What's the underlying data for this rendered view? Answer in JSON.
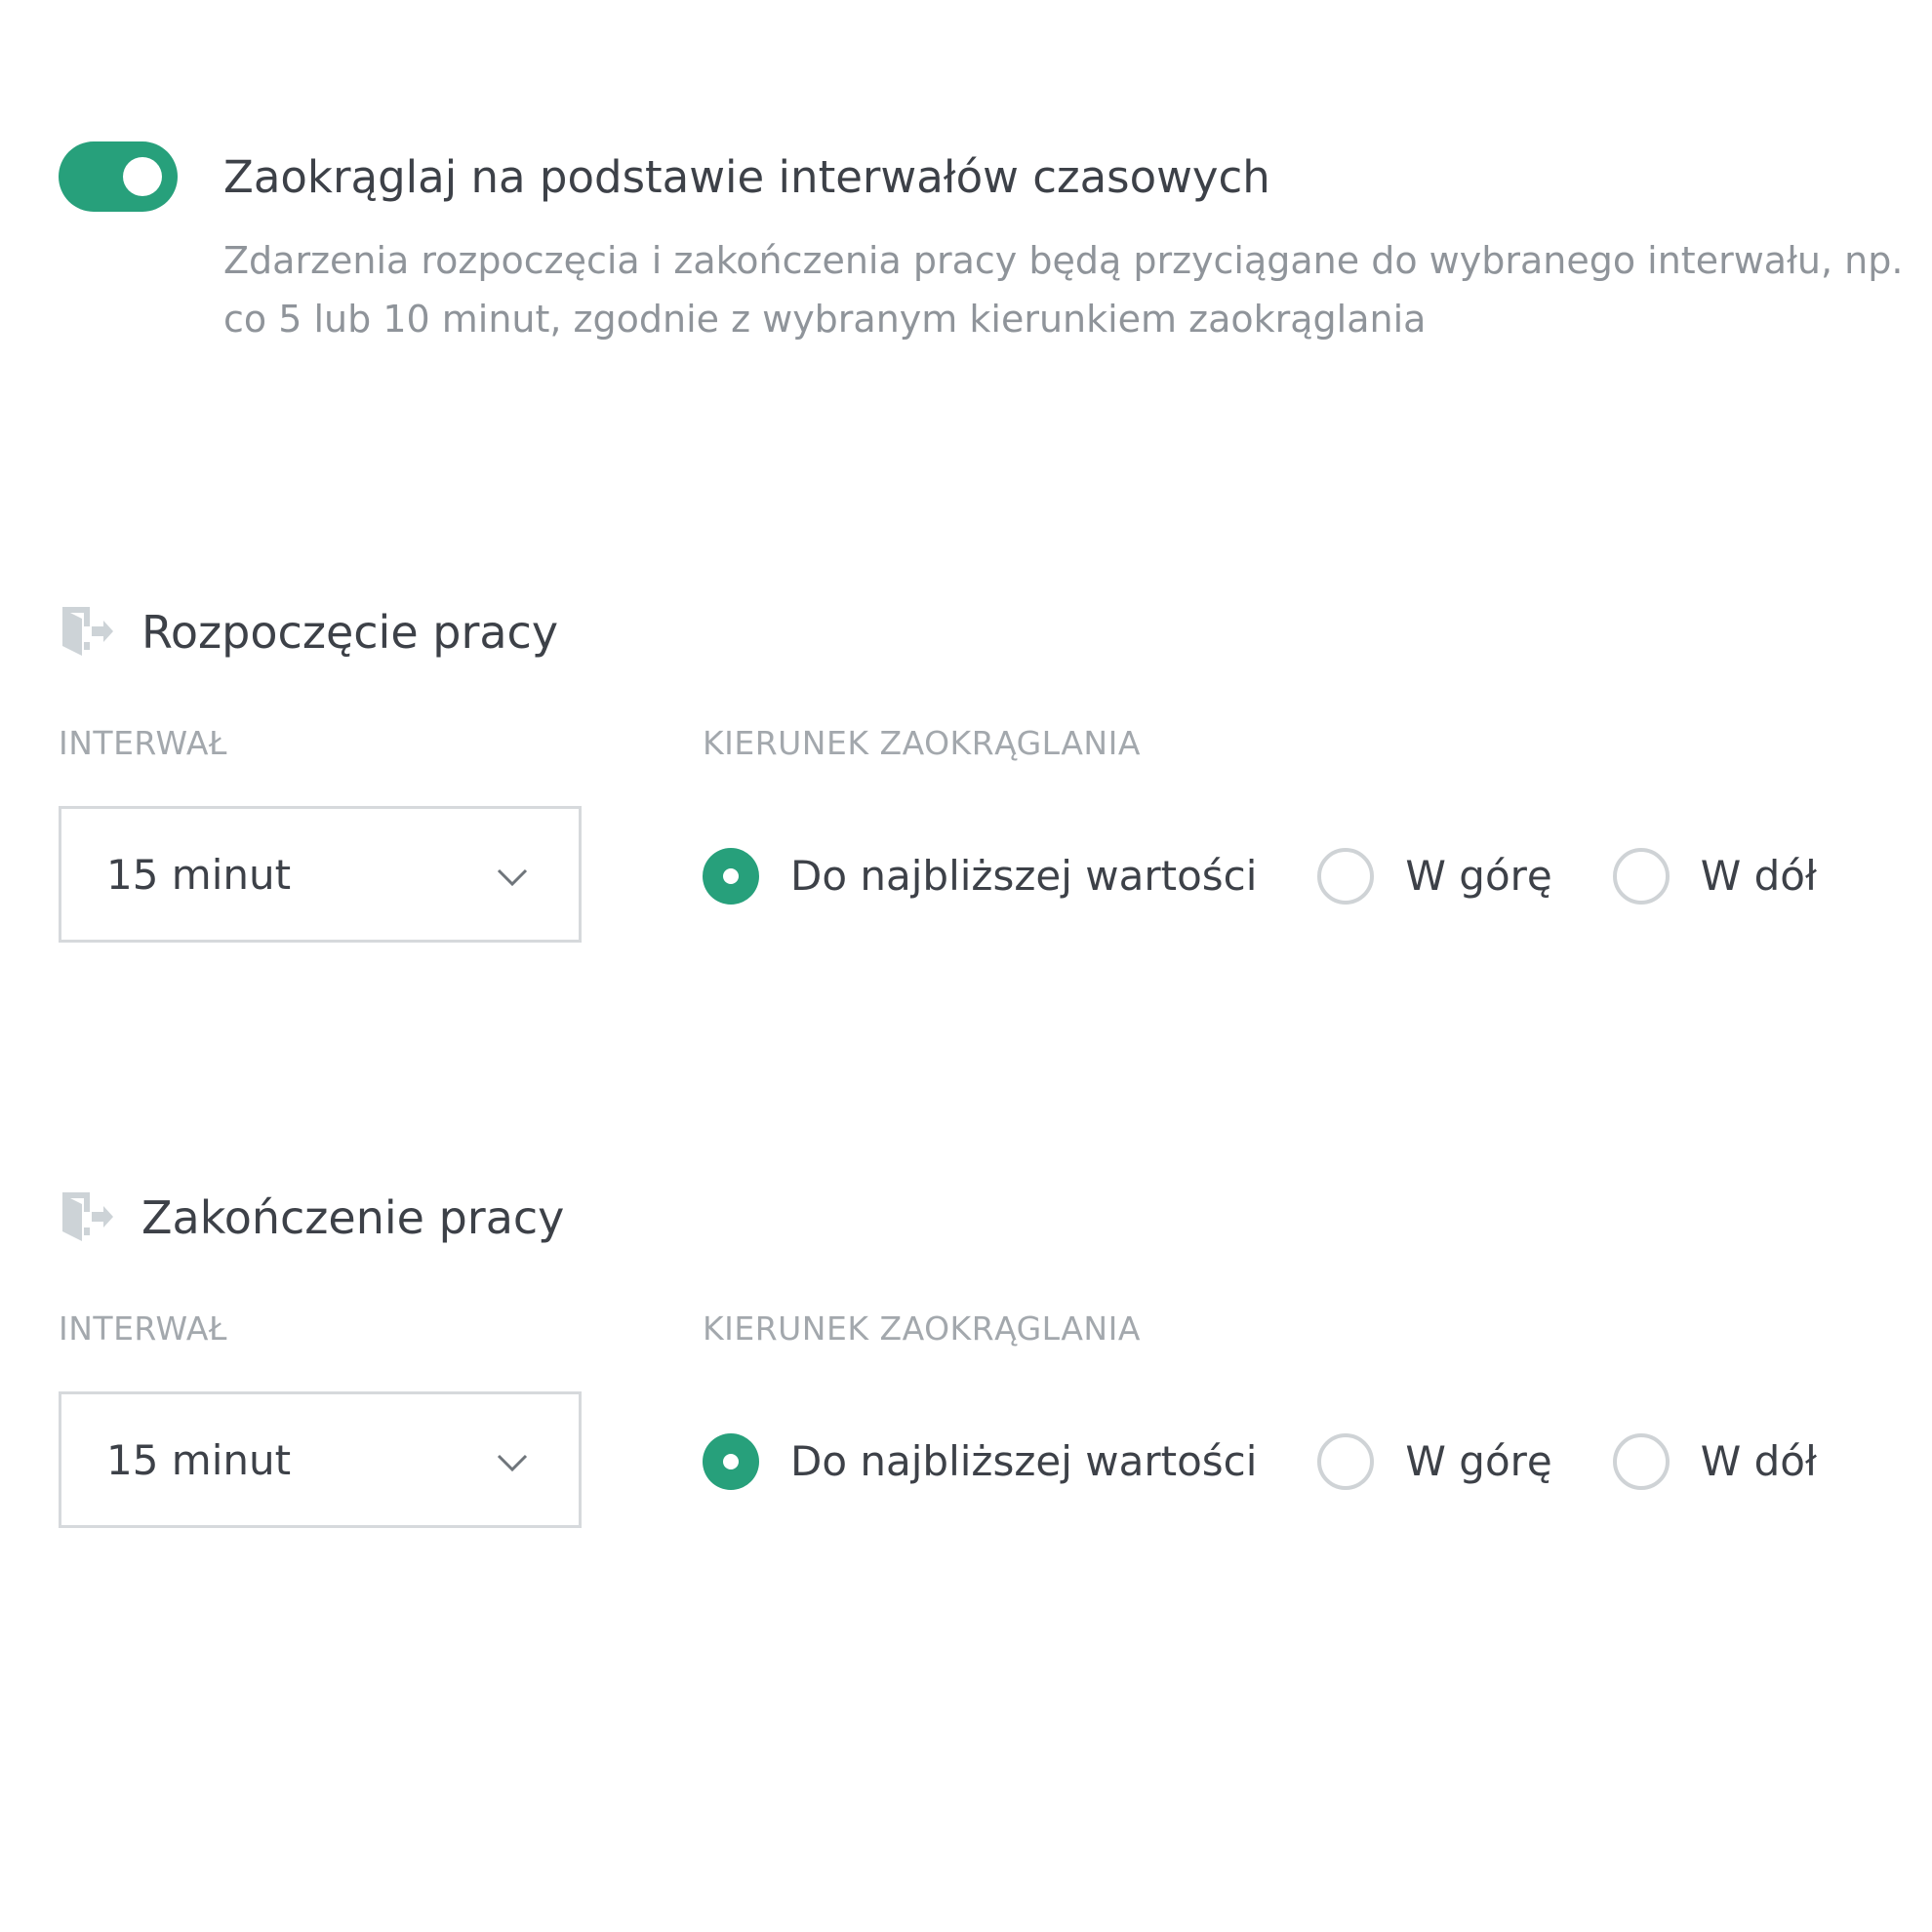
{
  "rounding": {
    "enabled": true,
    "title": "Zaokrąglaj na podstawie interwałów czasowych",
    "description": "Zdarzenia rozpoczęcia i zakończenia pracy będą przyciągane do wybranego interwału, np. co 5 lub 10 minut, zgodnie z wybranym kierunkiem zaokrąglania"
  },
  "colors": {
    "accent": "#27a07b",
    "text": "#3d4148",
    "muted": "#8f949a",
    "label": "#a3a8ad",
    "border": "#d6d9dc"
  },
  "sections": [
    {
      "title": "Rozpoczęcie pracy",
      "icon": "door-enter-icon",
      "interval_label": "INTERWAŁ",
      "interval_value": "15 minut",
      "direction_label": "KIERUNEK ZAOKRĄGLANIA",
      "options": [
        "Do najbliższej wartości",
        "W górę",
        "W dół"
      ],
      "selected_option": "Do najbliższej wartości"
    },
    {
      "title": "Zakończenie pracy",
      "icon": "door-exit-icon",
      "interval_label": "INTERWAŁ",
      "interval_value": "15 minut",
      "direction_label": "KIERUNEK ZAOKRĄGLANIA",
      "options": [
        "Do najbliższej wartości",
        "W górę",
        "W dół"
      ],
      "selected_option": "Do najbliższej wartości"
    }
  ]
}
